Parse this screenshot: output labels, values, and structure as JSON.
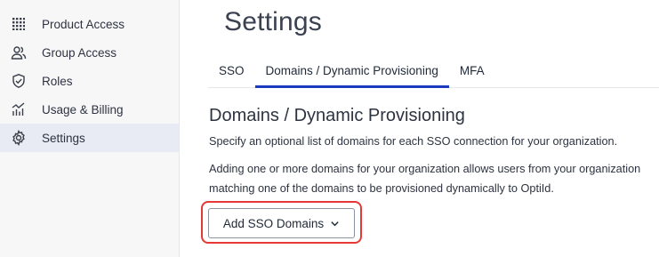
{
  "sidebar": {
    "items": [
      {
        "label": "Product Access",
        "icon": "grid-icon",
        "active": false
      },
      {
        "label": "Group Access",
        "icon": "users-icon",
        "active": false
      },
      {
        "label": "Roles",
        "icon": "shield-check-icon",
        "active": false
      },
      {
        "label": "Usage & Billing",
        "icon": "chart-icon",
        "active": false
      },
      {
        "label": "Settings",
        "icon": "gear-icon",
        "active": true
      }
    ]
  },
  "main": {
    "title": "Settings",
    "tabs": [
      {
        "label": "SSO",
        "active": false
      },
      {
        "label": "Domains / Dynamic Provisioning",
        "active": true
      },
      {
        "label": "MFA",
        "active": false
      }
    ],
    "section_title": "Domains / Dynamic Provisioning",
    "description_1": "Specify an optional list of domains for each SSO connection for your organization.",
    "description_2": "Adding one or more domains for your organization allows users from your organization matching one of the domains to be provisioned dynamically to OptiId.",
    "add_button_label": "Add SSO Domains"
  },
  "colors": {
    "accent": "#1d3bbf",
    "highlight": "#e53935",
    "sidebar_bg": "#f7f7f8",
    "sidebar_active_bg": "#e8ebf3"
  }
}
